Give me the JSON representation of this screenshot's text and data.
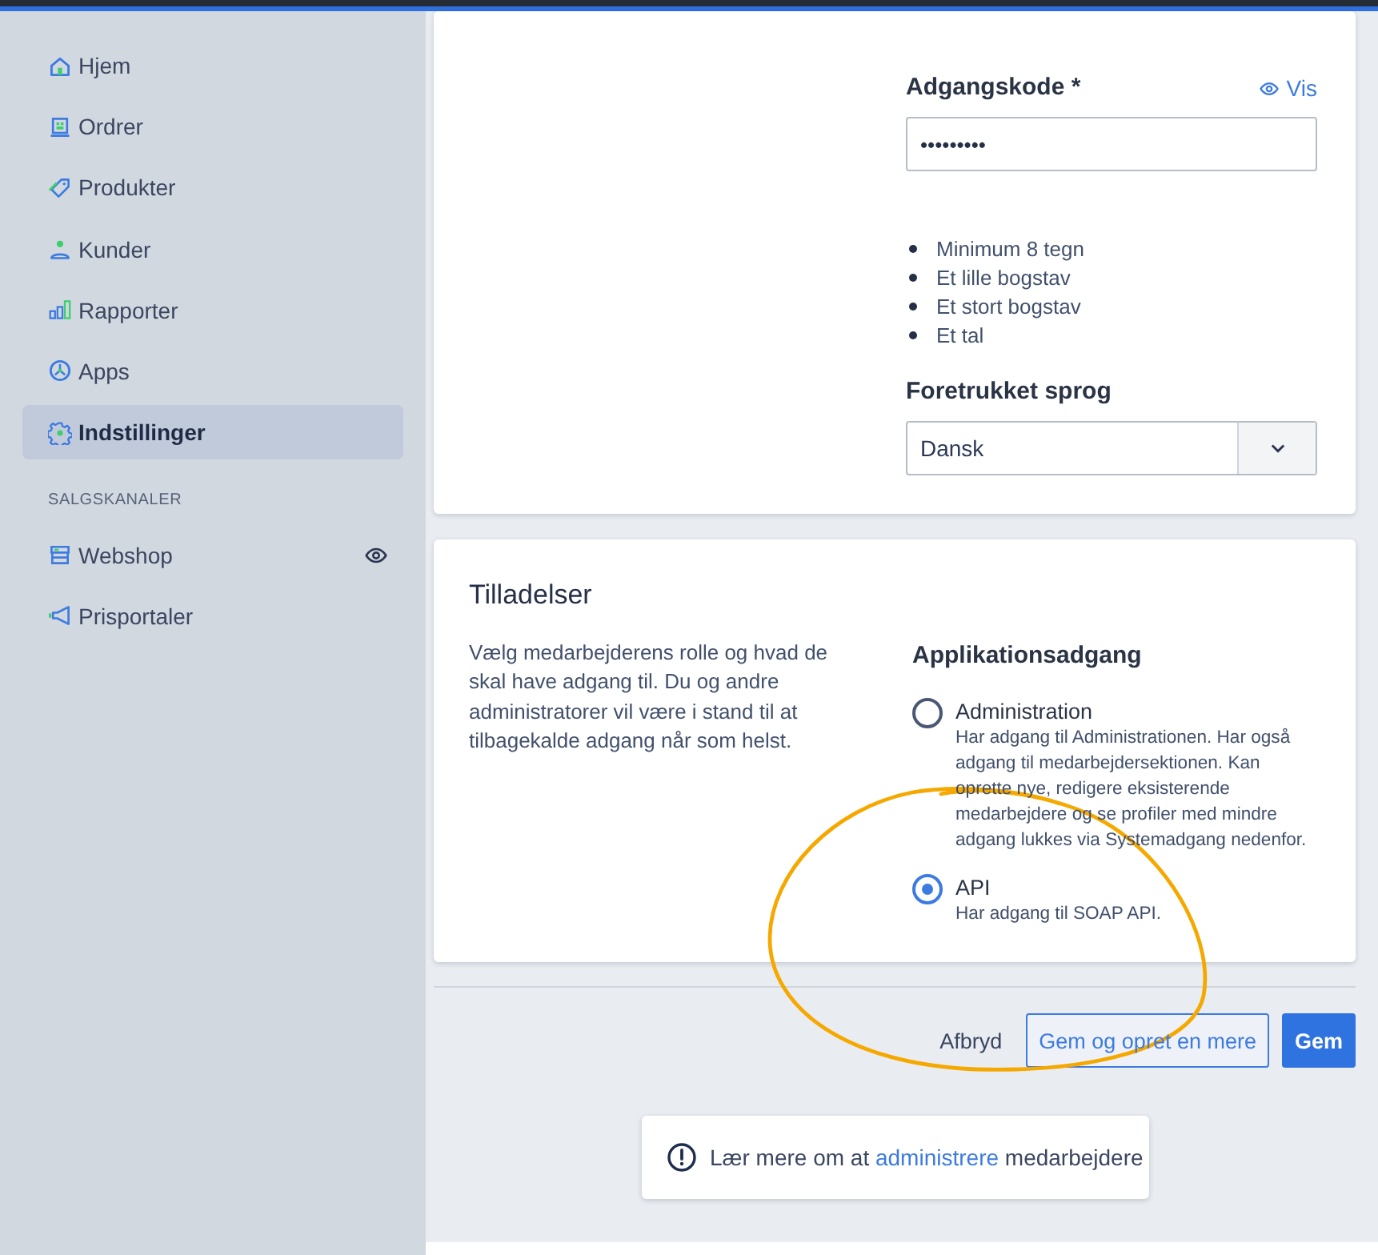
{
  "sidebar": {
    "items": [
      {
        "label": "Hjem",
        "selected": false
      },
      {
        "label": "Ordrer",
        "selected": false
      },
      {
        "label": "Produkter",
        "selected": false
      },
      {
        "label": "Kunder",
        "selected": false
      },
      {
        "label": "Rapporter",
        "selected": false
      },
      {
        "label": "Apps",
        "selected": false
      },
      {
        "label": "Indstillinger",
        "selected": true
      }
    ],
    "section_title": "SALGSKANALER",
    "channels": [
      {
        "label": "Webshop",
        "selected": false,
        "viewable": true
      },
      {
        "label": "Prisportaler",
        "selected": false,
        "viewable": false
      }
    ]
  },
  "account_card": {
    "password": {
      "label": "Adgangskode *",
      "show_link": "Vis",
      "value": "•••••••••"
    },
    "requirements": [
      "Minimum 8 tegn",
      "Et lille bogstav",
      "Et stort bogstav",
      "Et tal"
    ],
    "language": {
      "label": "Foretrukket sprog",
      "value": "Dansk"
    }
  },
  "permissions": {
    "title": "Tilladelser",
    "description": "Vælg medarbejderens rolle og hvad de skal have adgang til. Du og andre administratorer vil være i stand til at tilbagekalde adgang når som helst.",
    "access_title": "Applikationsadgang",
    "options": [
      {
        "label": "Administration",
        "description": "Har adgang til Administrationen. Har også adgang til medarbejdersektionen. Kan oprette nye, redigere eksisterende medarbejdere og se profiler med mindre adgang lukkes via Systemadgang nedenfor.",
        "selected": false
      },
      {
        "label": "API",
        "description": "Har adgang til SOAP API.",
        "selected": true
      }
    ]
  },
  "actions": [
    {
      "label": "Afbryd",
      "kind": "text"
    },
    {
      "label": "Gem og opret en mere",
      "kind": "outline"
    },
    {
      "label": "Gem",
      "kind": "primary"
    }
  ],
  "help": {
    "text_before": "Lær mere om at",
    "link": "administrere",
    "text_after": "medarbejdere"
  }
}
